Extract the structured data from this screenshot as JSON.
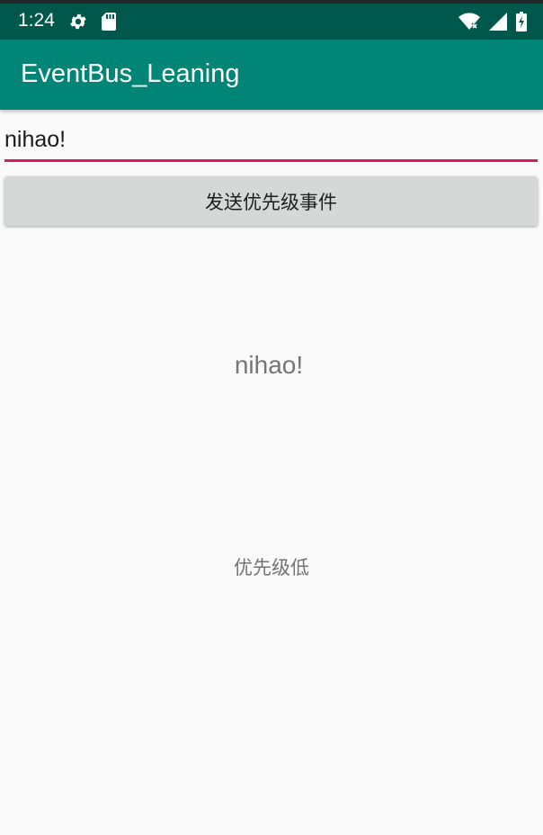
{
  "status_bar": {
    "time": "1:24",
    "icons": [
      "settings-icon",
      "sd-card-icon",
      "wifi-icon",
      "signal-icon",
      "battery-icon"
    ],
    "colors": {
      "background": "#00574b",
      "foreground": "#ffffff"
    }
  },
  "app_bar": {
    "title": "EventBus_Leaning",
    "color": "#008577"
  },
  "input": {
    "value": "nihao!",
    "underline_color": "#d81b60"
  },
  "button": {
    "label": "发送优先级事件"
  },
  "main": {
    "message": "nihao!",
    "priority_label": "优先级低"
  }
}
